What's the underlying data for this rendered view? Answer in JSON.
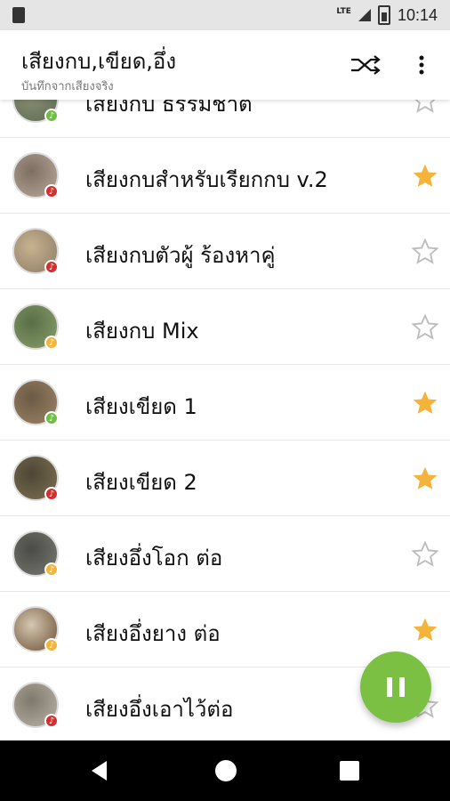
{
  "status_bar": {
    "network": "LTE",
    "time": "10:14"
  },
  "toolbar": {
    "title": "เสียงกบ,เขียด,อึ่ง",
    "subtitle": "บันทึกจากเสียงจริง"
  },
  "items": [
    {
      "label": "เสียงกบ ธรรมชาติ",
      "badge": "green",
      "starred": false,
      "thumb": [
        "#5e6b55",
        "#8a8f72"
      ]
    },
    {
      "label": "เสียงกบสำหรับเรียกกบ v.2",
      "badge": "red",
      "starred": true,
      "thumb": [
        "#b8a99a",
        "#7d6e62"
      ]
    },
    {
      "label": "เสียงกบตัวผู้ ร้องหาคู่",
      "badge": "red",
      "starred": false,
      "thumb": [
        "#8b7c66",
        "#c8b28f"
      ]
    },
    {
      "label": "เสียงกบ Mix",
      "badge": "orange",
      "starred": false,
      "thumb": [
        "#88a06b",
        "#5a6d46"
      ]
    },
    {
      "label": "เสียงเขียด 1",
      "badge": "green",
      "starred": true,
      "thumb": [
        "#9c8566",
        "#6c5a45"
      ]
    },
    {
      "label": "เสียงเขียด 2",
      "badge": "red",
      "starred": true,
      "thumb": [
        "#7e7254",
        "#4d4634"
      ]
    },
    {
      "label": "เสียงอึ่งโอก ต่อ",
      "badge": "orange",
      "starred": false,
      "thumb": [
        "#7a7a74",
        "#4a4a46"
      ]
    },
    {
      "label": "เสียงอึ่งยาง ต่อ",
      "badge": "orange",
      "starred": true,
      "thumb": [
        "#6b4f34",
        "#d5c7b1"
      ]
    },
    {
      "label": "เสียงอึ่งเอาไว้ต่อ",
      "badge": "red",
      "starred": false,
      "thumb": [
        "#b9b2a6",
        "#7f786c"
      ]
    }
  ],
  "colors": {
    "accent": "#7bc043",
    "star_filled": "#f4b33b",
    "star_empty": "#bdbdbd",
    "badge_green": "#6fbe44",
    "badge_red": "#d32f2f",
    "badge_orange": "#f4b33b"
  }
}
